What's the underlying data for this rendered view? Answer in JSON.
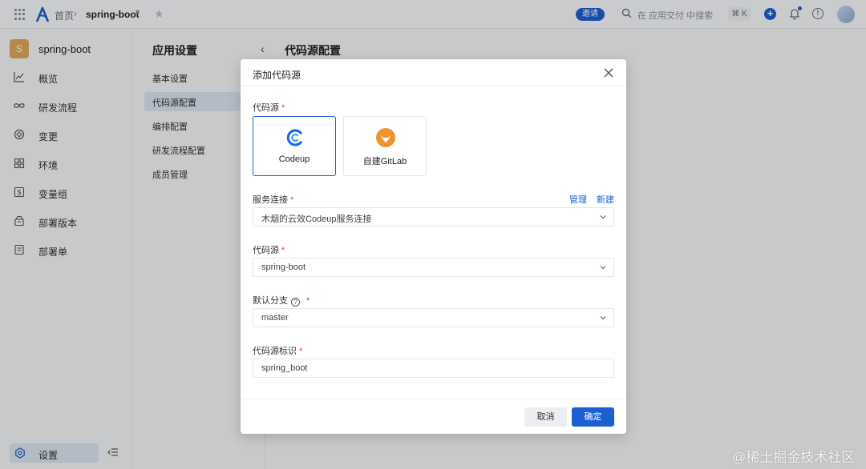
{
  "topbar": {
    "home": "首页",
    "project": "spring-boot",
    "invite": "邀请",
    "search_placeholder": "在 应用交付 中搜索",
    "shortcut": "⌘ K"
  },
  "sidebar": {
    "project_initial": "S",
    "project_name": "spring-boot",
    "items": [
      {
        "label": "概览",
        "icon": "chart-line-icon"
      },
      {
        "label": "研发流程",
        "icon": "infinity-icon"
      },
      {
        "label": "变更",
        "icon": "change-icon"
      },
      {
        "label": "环境",
        "icon": "grid-squares-icon"
      },
      {
        "label": "变量组",
        "icon": "variable-icon"
      },
      {
        "label": "部署版本",
        "icon": "package-icon"
      },
      {
        "label": "部署单",
        "icon": "document-icon"
      }
    ],
    "settings": "设置"
  },
  "subnav": {
    "title": "应用设置",
    "items": [
      {
        "label": "基本设置"
      },
      {
        "label": "代码源配置"
      },
      {
        "label": "编排配置"
      },
      {
        "label": "研发流程配置"
      },
      {
        "label": "成员管理"
      }
    ]
  },
  "main": {
    "title": "代码源配置"
  },
  "modal": {
    "title": "添加代码源",
    "source_label": "代码源",
    "sources": [
      {
        "name": "Codeup",
        "selected": true
      },
      {
        "name": "自建GitLab",
        "selected": false
      }
    ],
    "service_label": "服务连接",
    "manage_link": "管理",
    "new_link": "新建",
    "service_value": "木烟的云效Codeup服务连接",
    "repo_label": "代码源",
    "repo_value": "spring-boot",
    "branch_label": "默认分支",
    "branch_value": "master",
    "id_label": "代码源标识",
    "id_value": "spring_boot",
    "cancel": "取消",
    "confirm": "确定",
    "required_mark": "*"
  },
  "watermark": "@稀土掘金技术社区",
  "colors": {
    "primary": "#1b5fd1",
    "required": "#e0483d"
  }
}
